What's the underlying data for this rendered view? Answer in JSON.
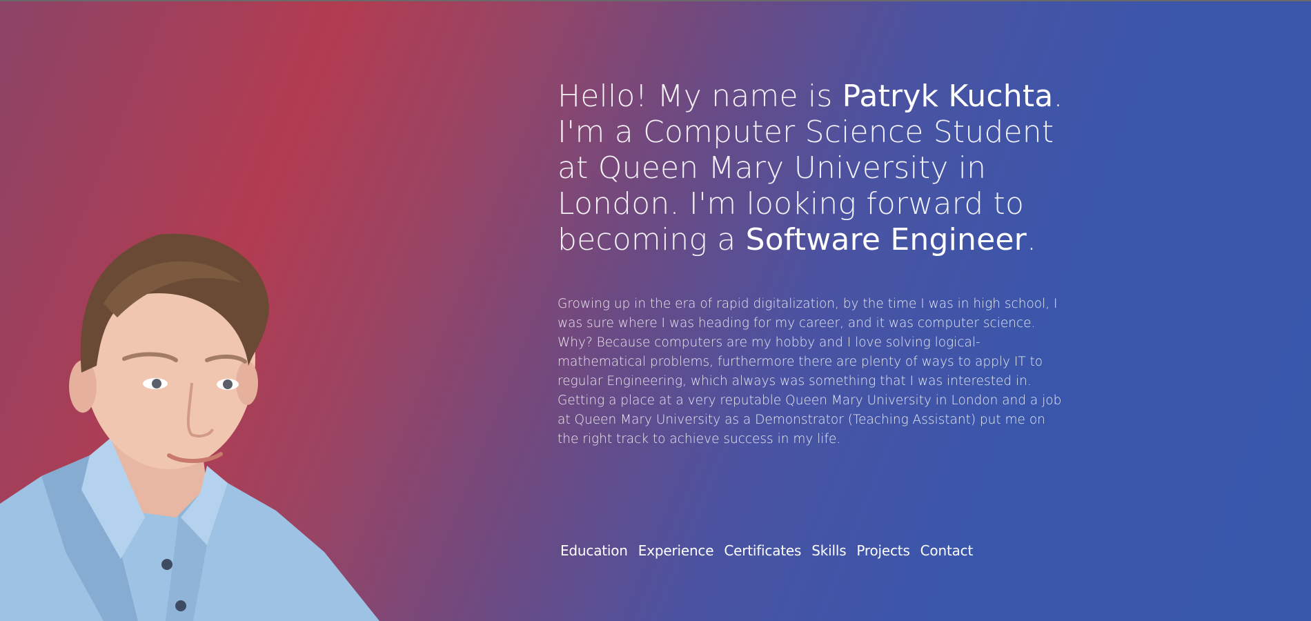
{
  "hero": {
    "intro_segments": [
      {
        "text": "Hello! My name is ",
        "style": "light"
      },
      {
        "text": "Patryk Kuchta",
        "style": "strong"
      },
      {
        "text": ". I'm a Computer Science Student at Queen Mary University in London. I'm looking forward to becoming a ",
        "style": "light"
      },
      {
        "text": "Software Engineer",
        "style": "strong"
      },
      {
        "text": ".",
        "style": "light"
      }
    ],
    "bio": "Growing up in the era of rapid digitalization, by the time I was in high school, I was sure where I was heading for my career, and it was computer science. Why? Because computers are my hobby and I love solving logical-mathematical problems, furthermore there are plenty of ways to apply IT to regular Engineering, which always was something that I was interested in. Getting a place at a very reputable Queen Mary University in London and a job at Queen Mary University as a Demonstrator (Teaching Assistant) put me on the right track to achieve success in my life."
  },
  "nav": {
    "items": [
      {
        "label": "Education"
      },
      {
        "label": "Experience"
      },
      {
        "label": "Certificates"
      },
      {
        "label": "Skills"
      },
      {
        "label": "Projects"
      },
      {
        "label": "Contact"
      }
    ]
  },
  "colors": {
    "gradient_red": "#b23c51",
    "gradient_purple": "#6c4a82",
    "gradient_blue": "#3857ab",
    "text": "#ffffff"
  }
}
